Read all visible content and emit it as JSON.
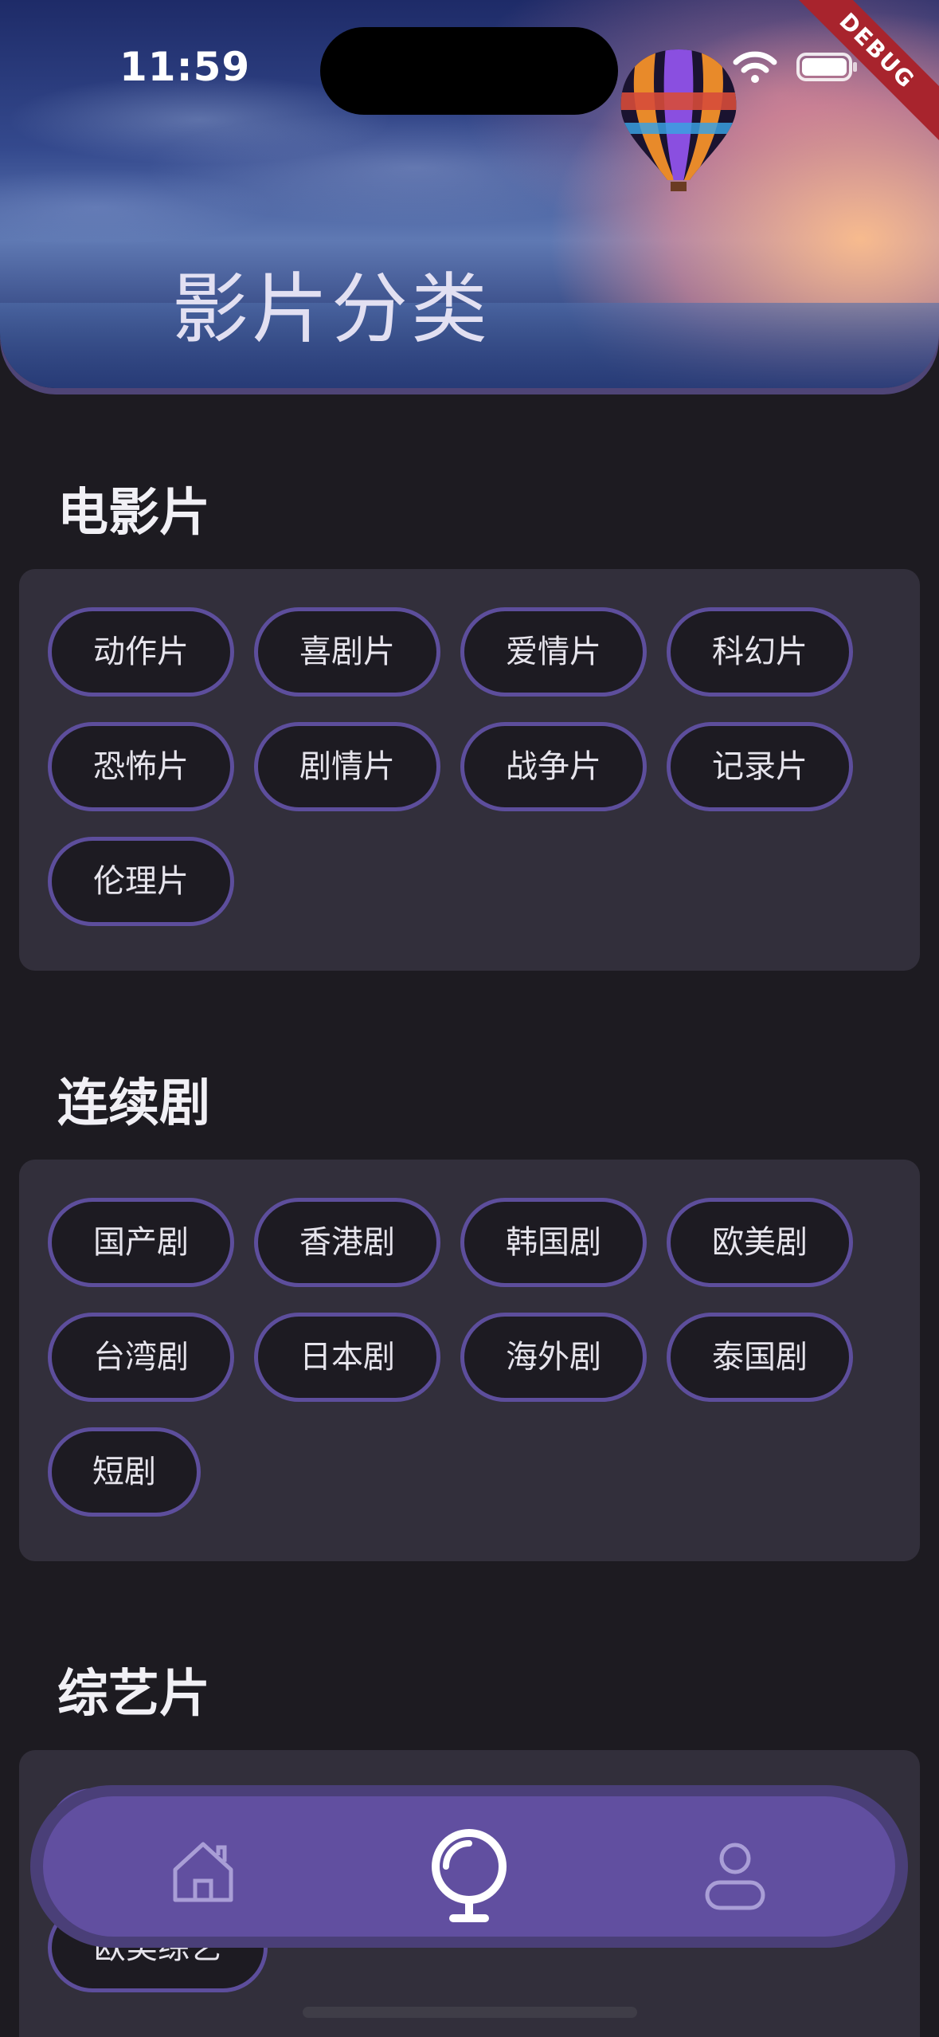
{
  "status_bar": {
    "time": "11:59"
  },
  "debug_banner": "DEBUG",
  "header": {
    "title": "影片分类"
  },
  "sections": [
    {
      "title": "电影片",
      "chips": [
        "动作片",
        "喜剧片",
        "爱情片",
        "科幻片",
        "恐怖片",
        "剧情片",
        "战争片",
        "记录片",
        "伦理片"
      ]
    },
    {
      "title": "连续剧",
      "chips": [
        "国产剧",
        "香港剧",
        "韩国剧",
        "欧美剧",
        "台湾剧",
        "日本剧",
        "海外剧",
        "泰国剧",
        "短剧"
      ]
    },
    {
      "title": "综艺片",
      "chips": [
        "欧美综艺"
      ]
    }
  ],
  "bottom_nav": {
    "items": [
      {
        "icon": "home-icon",
        "active": false
      },
      {
        "icon": "discover-icon",
        "active": true
      },
      {
        "icon": "profile-icon",
        "active": false
      }
    ]
  },
  "colors": {
    "background": "#1d1b21",
    "panel": "#322f3b",
    "chip_border": "#5d4e9c",
    "nav": "#614fa0"
  }
}
